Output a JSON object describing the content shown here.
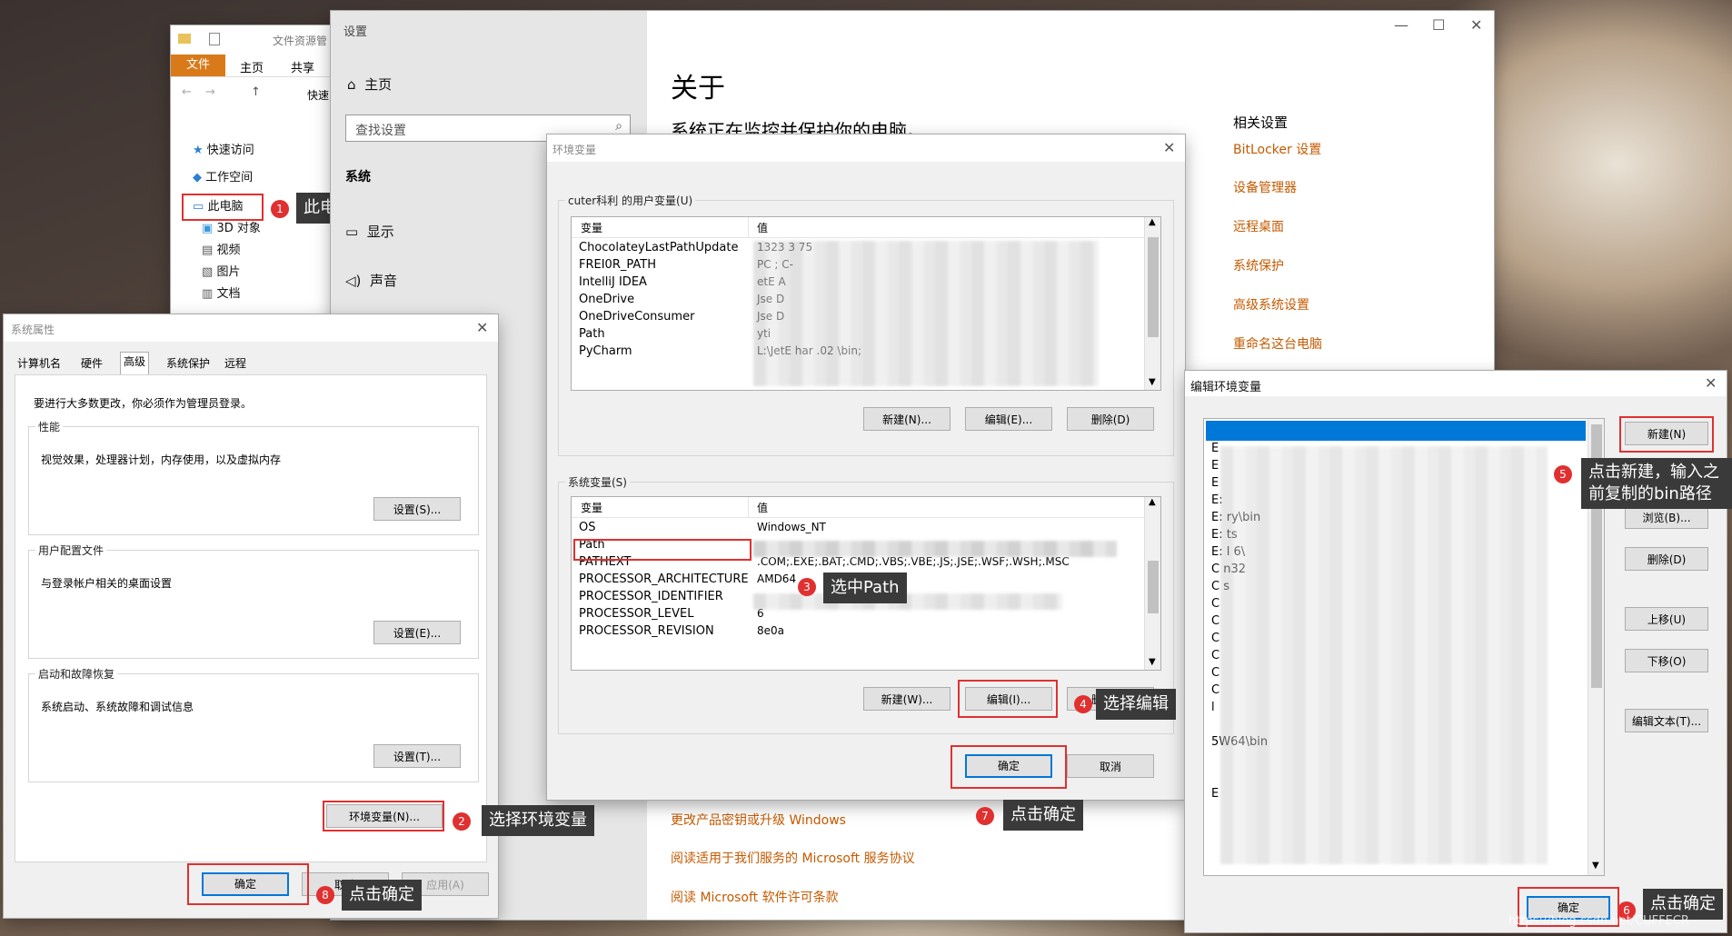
{
  "explorer": {
    "title": "文件资源管",
    "menu": [
      "文件",
      "主页",
      "共享"
    ],
    "address": "快速",
    "nav_items": [
      "快速访问",
      "工作空间",
      "此电脑",
      "3D 对象",
      "视频",
      "图片",
      "文档"
    ]
  },
  "settings": {
    "window_title": "设置",
    "home": "主页",
    "search_placeholder": "查找设置",
    "section": "系统",
    "nav": [
      "显示",
      "声音"
    ],
    "heading": "关于",
    "subtitle": "系统正在监控并保护你的电脑。",
    "related_title": "相关设置",
    "related_links": [
      "BitLocker 设置",
      "设备管理器",
      "远程桌面",
      "系统保护",
      "高级系统设置",
      "重命名这台电脑"
    ],
    "bottom_links": [
      "更改产品密钥或升级 Windows",
      "阅读适用于我们服务的 Microsoft 服务协议",
      "阅读 Microsoft 软件许可条款"
    ]
  },
  "sysprops": {
    "title": "系统属性",
    "tabs": [
      "计算机名",
      "硬件",
      "高级",
      "系统保护",
      "远程"
    ],
    "admin_note": "要进行大多数更改，你必须作为管理员登录。",
    "groups": [
      {
        "label": "性能",
        "desc": "视觉效果，处理器计划，内存使用，以及虚拟内存",
        "button": "设置(S)..."
      },
      {
        "label": "用户配置文件",
        "desc": "与登录帐户相关的桌面设置",
        "button": "设置(E)..."
      },
      {
        "label": "启动和故障恢复",
        "desc": "系统启动、系统故障和调试信息",
        "button": "设置(T)..."
      }
    ],
    "env_button": "环境变量(N)...",
    "ok": "确定",
    "cancel": "取消",
    "apply": "应用(A)"
  },
  "envvars": {
    "title": "环境变量",
    "user_label": "cuter科利 的用户变量(U)",
    "col_var": "变量",
    "col_val": "值",
    "user_vars": [
      {
        "name": "ChocolateyLastPathUpdate",
        "value": "1323        3     75"
      },
      {
        "name": "FREI0R_PATH",
        "value": "  PC    ;      C-"
      },
      {
        "name": "IntelliJ IDEA",
        "value": "  etE          A"
      },
      {
        "name": "OneDrive",
        "value": "  Jse         D"
      },
      {
        "name": "OneDriveConsumer",
        "value": "  Jse         D"
      },
      {
        "name": "Path",
        "value": "  yti"
      },
      {
        "name": "PyCharm",
        "value": "L:\\JetE      har   .02      \\bin;"
      }
    ],
    "user_buttons": [
      "新建(N)...",
      "编辑(E)...",
      "删除(D)"
    ],
    "sys_label": "系统变量(S)",
    "sys_vars": [
      {
        "name": "OS",
        "value": "Windows_NT"
      },
      {
        "name": "Path",
        "value": ""
      },
      {
        "name": "PATHEXT",
        "value": ".COM;.EXE;.BAT;.CMD;.VBS;.VBE;.JS;.JSE;.WSF;.WSH;.MSC"
      },
      {
        "name": "PROCESSOR_ARCHITECTURE",
        "value": "AMD64"
      },
      {
        "name": "PROCESSOR_IDENTIFIER",
        "value": ""
      },
      {
        "name": "PROCESSOR_LEVEL",
        "value": "6"
      },
      {
        "name": "PROCESSOR_REVISION",
        "value": "8e0a"
      }
    ],
    "sys_buttons": [
      "新建(W)...",
      "编辑(I)...",
      "删"
    ],
    "ok": "确定",
    "cancel": "取消"
  },
  "editenv": {
    "title": "编辑环境变量",
    "entries": [
      "",
      "E",
      "E",
      "E",
      "E:        ",
      "E:           ry\\bin",
      "E:              ts",
      "E:              l 6\\",
      "C          n32",
      "C          s",
      "C",
      "C",
      "C",
      "C",
      "C",
      "C",
      "l",
      "",
      "              5W64\\bin",
      "",
      "",
      "E"
    ],
    "buttons": [
      "新建(N)",
      "浏览(B)...",
      "删除(D)",
      "上移(U)",
      "下移(O)",
      "编辑文本(T)..."
    ],
    "ok": "确定"
  },
  "annotations": [
    {
      "num": "1",
      "text": "此电脑右键，选择属性"
    },
    {
      "num": "2",
      "text": "选择环境变量"
    },
    {
      "num": "3",
      "text": "选中Path"
    },
    {
      "num": "4",
      "text": "选择编辑"
    },
    {
      "num": "5",
      "text": "点击新建，输入之前复制的bin路径"
    },
    {
      "num": "6",
      "text": "点击确定"
    },
    {
      "num": "7",
      "text": "点击确定"
    },
    {
      "num": "8",
      "text": "点击确定"
    }
  ],
  "watermark": "https://blog.csdn.net/CUFFECR"
}
